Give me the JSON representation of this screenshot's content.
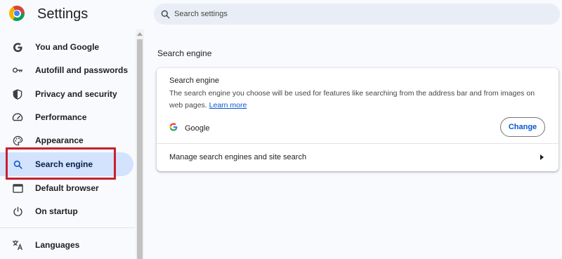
{
  "header": {
    "title": "Settings",
    "search_placeholder": "Search settings"
  },
  "sidebar": {
    "items": [
      {
        "label": "You and Google",
        "icon": "google-g-icon"
      },
      {
        "label": "Autofill and passwords",
        "icon": "key-icon"
      },
      {
        "label": "Privacy and security",
        "icon": "shield-icon"
      },
      {
        "label": "Performance",
        "icon": "speedometer-icon"
      },
      {
        "label": "Appearance",
        "icon": "palette-icon"
      },
      {
        "label": "Search engine",
        "icon": "search-icon",
        "active": true
      },
      {
        "label": "Default browser",
        "icon": "browser-window-icon"
      },
      {
        "label": "On startup",
        "icon": "power-icon"
      },
      {
        "label": "Languages",
        "icon": "translate-icon"
      }
    ]
  },
  "main": {
    "section_title": "Search engine",
    "card": {
      "heading": "Search engine",
      "description": "The search engine you choose will be used for features like searching from the address bar and from images on web pages.",
      "learn_more": "Learn more",
      "engine_name": "Google",
      "change_label": "Change",
      "manage_label": "Manage search engines and site search"
    }
  },
  "colors": {
    "accent": "#0b57d0",
    "active_nav_bg": "#d3e3fd",
    "highlight_box": "#c8202f"
  }
}
